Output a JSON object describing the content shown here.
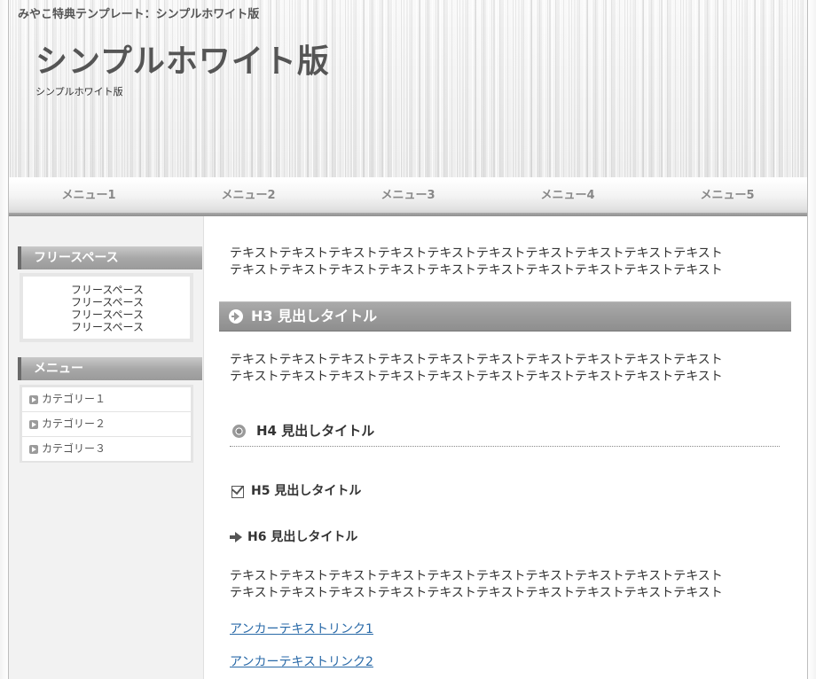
{
  "header": {
    "tagline": "みやこ特典テンプレート：シンプルホワイト版",
    "title": "シンプルホワイト版",
    "description": "シンプルホワイト版"
  },
  "nav": {
    "items": [
      "メニュー1",
      "メニュー2",
      "メニュー3",
      "メニュー4",
      "メニュー5"
    ]
  },
  "sidebar": {
    "free_space_heading": "フリースペース",
    "free_space_lines": [
      "フリースペース",
      "フリースペース",
      "フリースペース",
      "フリースペース"
    ],
    "menu_heading": "メニュー",
    "categories": [
      "カテゴリー１",
      "カテゴリー２",
      "カテゴリー３"
    ]
  },
  "main": {
    "paragraph1": [
      "テキストテキストテキストテキストテキストテキストテキストテキストテキストテキスト",
      "テキストテキストテキストテキストテキストテキストテキストテキストテキストテキスト"
    ],
    "h3": "H3 見出しタイトル",
    "paragraph2": [
      "テキストテキストテキストテキストテキストテキストテキストテキストテキストテキスト",
      "テキストテキストテキストテキストテキストテキストテキストテキストテキストテキスト"
    ],
    "h4": "H4 見出しタイトル",
    "h5": "H5 見出しタイトル",
    "h6": "H6 見出しタイトル",
    "paragraph3": [
      "テキストテキストテキストテキストテキストテキストテキストテキストテキストテキスト",
      "テキストテキストテキストテキストテキストテキストテキストテキストテキストテキスト"
    ],
    "links": [
      "アンカーテキストリンク1",
      "アンカーテキストリンク2"
    ]
  }
}
